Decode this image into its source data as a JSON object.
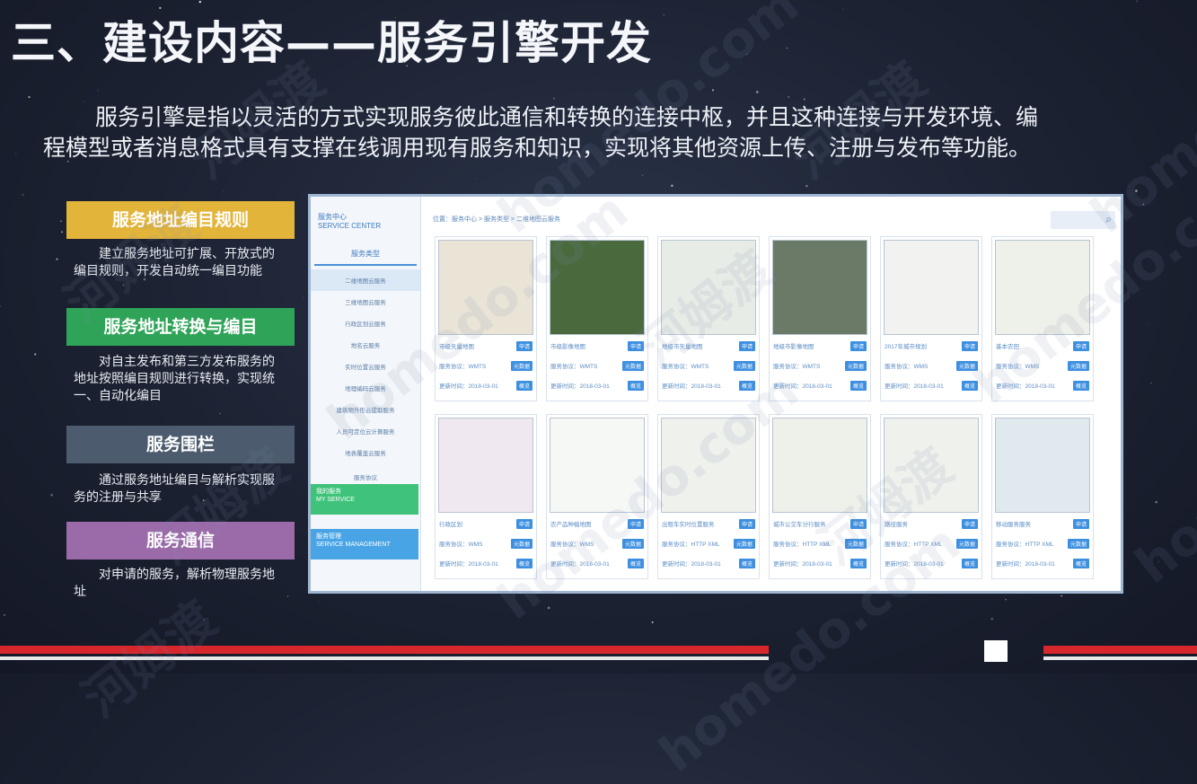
{
  "title": "三、建设内容——服务引擎开发",
  "intro": {
    "line1": "服务引擎是指以灵活的方式实现服务彼此通信和转换的连接中枢，并且这种连接与开发环境、编",
    "line2": "程模型或者消息格式具有支撑在线调用现有服务和知识，实现将其他资源上传、注册与发布等功能。"
  },
  "cards": [
    {
      "title": "服务地址编目规则",
      "color": "#e3b43a",
      "desc": "建立服务地址可扩展、开放式的编目规则，开发自动统一编目功能"
    },
    {
      "title": "服务地址转换与编目",
      "color": "#2fa458",
      "desc": "对自主发布和第三方发布服务的地址按照编目规则进行转换，实现统一、自动化编目"
    },
    {
      "title": "服务围栏",
      "color": "#4c5c6e",
      "desc": "通过服务地址编目与解析实现服务的注册与共享"
    },
    {
      "title": "服务通信",
      "color": "#9b6aa8",
      "desc": "对申请的服务，解析物理服务地址"
    }
  ],
  "watermark": {
    "cn": "河姆渡",
    "en": "homedo.com"
  },
  "screenshot": {
    "side": {
      "head_cn": "服务中心",
      "head_en": "SERVICE CENTER",
      "tab": "服务类型",
      "items": [
        "二维地图云服务",
        "三维地图云服务",
        "行政区划云服务",
        "地名云服务",
        "实时位置云服务",
        "地理编码云服务",
        "建筑物外形云提取服务",
        "人员可定位云计算服务",
        "地表覆盖云服务"
      ],
      "sub": "服务协议",
      "my_cn": "我的服务",
      "my_en": "MY SERVICE",
      "mgmt_cn": "服务管理",
      "mgmt_en": "SERVICE MANAGEMENT"
    },
    "breadcrumb": "位置：服务中心 > 服务类型 > 二维地图云服务",
    "search_icon": "search-icon",
    "tiles": [
      {
        "name": "市级矢量地图",
        "proto": "服务协议：WMTS",
        "time": "更新时间：2018-03-01",
        "b1": "申请",
        "b2": "元数据",
        "b3": "概览",
        "color": "#e9e4d6"
      },
      {
        "name": "市级影像地图",
        "proto": "服务协议：WMTS",
        "time": "更新时间：2018-03-01",
        "b1": "申请",
        "b2": "元数据",
        "b3": "概览",
        "color": "#4a6a3e"
      },
      {
        "name": "地级市矢量地图",
        "proto": "服务协议：WMTS",
        "time": "更新时间：2018-03-01",
        "b1": "申请",
        "b2": "元数据",
        "b3": "概览",
        "color": "#e8ece6"
      },
      {
        "name": "地级市影像地图",
        "proto": "服务协议：WMTS",
        "time": "更新时间：2018-03-01",
        "b1": "申请",
        "b2": "元数据",
        "b3": "概览",
        "color": "#6a7a66"
      },
      {
        "name": "2017年城市规划",
        "proto": "服务协议：WMS",
        "time": "更新时间：2018-03-01",
        "b1": "申请",
        "b2": "元数据",
        "b3": "概览",
        "color": "#f2f3f0"
      },
      {
        "name": "基本农田",
        "proto": "服务协议：WMS",
        "time": "更新时间：2018-03-01",
        "b1": "申请",
        "b2": "元数据",
        "b3": "概览",
        "color": "#eef0ea"
      },
      {
        "name": "行政区划",
        "proto": "服务协议：WMS",
        "time": "更新时间：2018-03-01",
        "b1": "申请",
        "b2": "元数据",
        "b3": "概览",
        "color": "#f0e8f0"
      },
      {
        "name": "农产品种植地图",
        "proto": "服务协议：WMS",
        "time": "更新时间：2018-03-01",
        "b1": "申请",
        "b2": "元数据",
        "b3": "概览",
        "color": "#f6f8f6"
      },
      {
        "name": "出租车实时位置服务",
        "proto": "服务协议：HTTP XML",
        "time": "更新时间：2018-03-01",
        "b1": "申请",
        "b2": "元数据",
        "b3": "概览",
        "color": "#eef1ec"
      },
      {
        "name": "城市公交车分行服务",
        "proto": "服务协议：HTTP XML",
        "time": "更新时间：2018-03-01",
        "b1": "申请",
        "b2": "元数据",
        "b3": "概览",
        "color": "#eef0ea"
      },
      {
        "name": "路径服务",
        "proto": "服务协议：HTTP XML",
        "time": "更新时间：2018-03-01",
        "b1": "申请",
        "b2": "元数据",
        "b3": "概览",
        "color": "#eff1ec"
      },
      {
        "name": "移动服务服务",
        "proto": "服务协议：HTTP XML",
        "time": "更新时间：2018-03-01",
        "b1": "申请",
        "b2": "元数据",
        "b3": "概览",
        "color": "#dfe9ee"
      }
    ]
  }
}
